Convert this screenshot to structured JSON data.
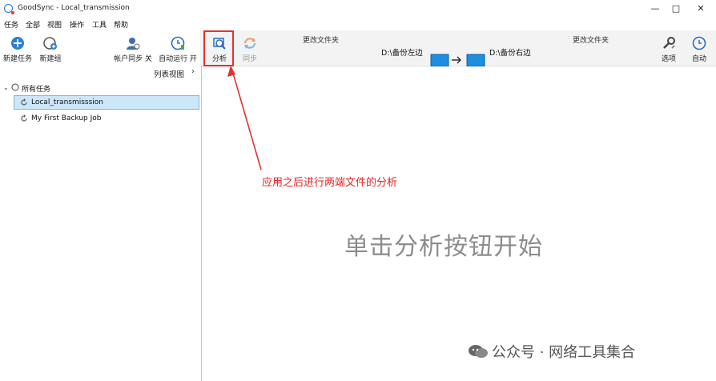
{
  "window": {
    "title": "GoodSync - Local_transmission",
    "min": "—",
    "max": "□",
    "close": "✕"
  },
  "menu": [
    "任务",
    "全部",
    "视图",
    "操作",
    "工具",
    "帮助"
  ],
  "toolbar": {
    "new_job": "新建任务",
    "new_group": "新建组",
    "account_sync": "帐户同步 关",
    "auto_run": "自动运行 开",
    "analyze": "分析",
    "sync": "同步",
    "change_folder_left": "更改文件夹",
    "change_folder_right": "更改文件夹",
    "left_path": "D:\\备份左边",
    "right_path": "D:\\备份右边",
    "options": "选项",
    "auto": "自动"
  },
  "left_panel": {
    "list_view": "列表视图",
    "list_view_arrow": "›",
    "root": "所有任务",
    "jobs": [
      "Local_transmisssion",
      "My First Backup Job"
    ]
  },
  "main": {
    "hint": "单击分析按钮开始",
    "annotation": "应用之后进行两端文件的分析"
  },
  "watermark": "公众号 · 网络工具集合",
  "colors": {
    "accent": "#2b7fd4",
    "annotation": "#e32222",
    "selected": "#cce6fa",
    "toolbar_bg": "#f3f3f3"
  }
}
